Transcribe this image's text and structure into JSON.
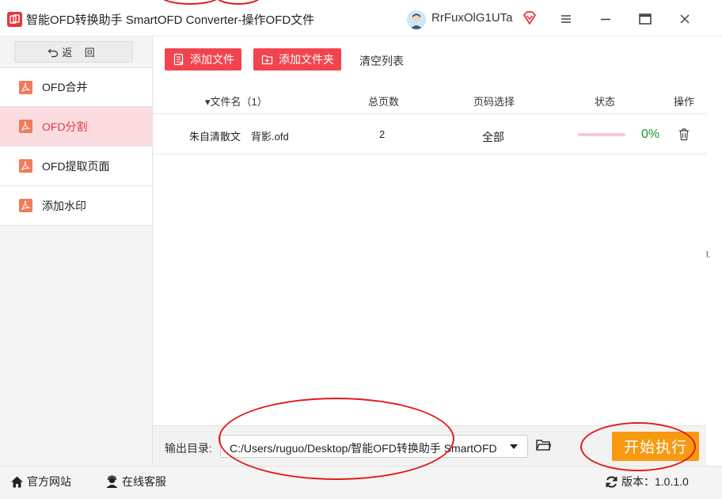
{
  "window": {
    "title": "智能OFD转换助手 SmartOFD Converter-操作OFD文件",
    "username": "RrFuxOlG1UTa"
  },
  "sidebar": {
    "back_label": "返 回",
    "items": [
      {
        "label": "OFD合并",
        "active": false
      },
      {
        "label": "OFD分割",
        "active": true
      },
      {
        "label": "OFD提取页面",
        "active": false
      },
      {
        "label": "添加水印",
        "active": false
      }
    ]
  },
  "toolbar": {
    "add_file": "添加文件",
    "add_folder": "添加文件夹",
    "clear_list": "清空列表"
  },
  "table": {
    "headers": {
      "name": "▾文件名（1）",
      "pages": "总页数",
      "range": "页码选择",
      "status": "状态",
      "action": "操作"
    },
    "rows": [
      {
        "name": "朱自清散文　背影.ofd",
        "pages": "2",
        "range": "全部",
        "progress": 0,
        "percent": "0%"
      }
    ]
  },
  "output": {
    "label": "输出目录:",
    "path": "C:/Users/ruguo/Desktop/智能OFD转换助手 SmartOFD Converter",
    "start_label": "开始执行"
  },
  "statusbar": {
    "site": "官方网站",
    "service": "在线客服",
    "version": "版本：1.0.1.0"
  },
  "colors": {
    "accent": "#f2444e",
    "active_bg": "#fbdde1",
    "start_button": "#f79a11",
    "percent_green": "#1c9a2a",
    "annotation_red": "#e21a1a"
  }
}
